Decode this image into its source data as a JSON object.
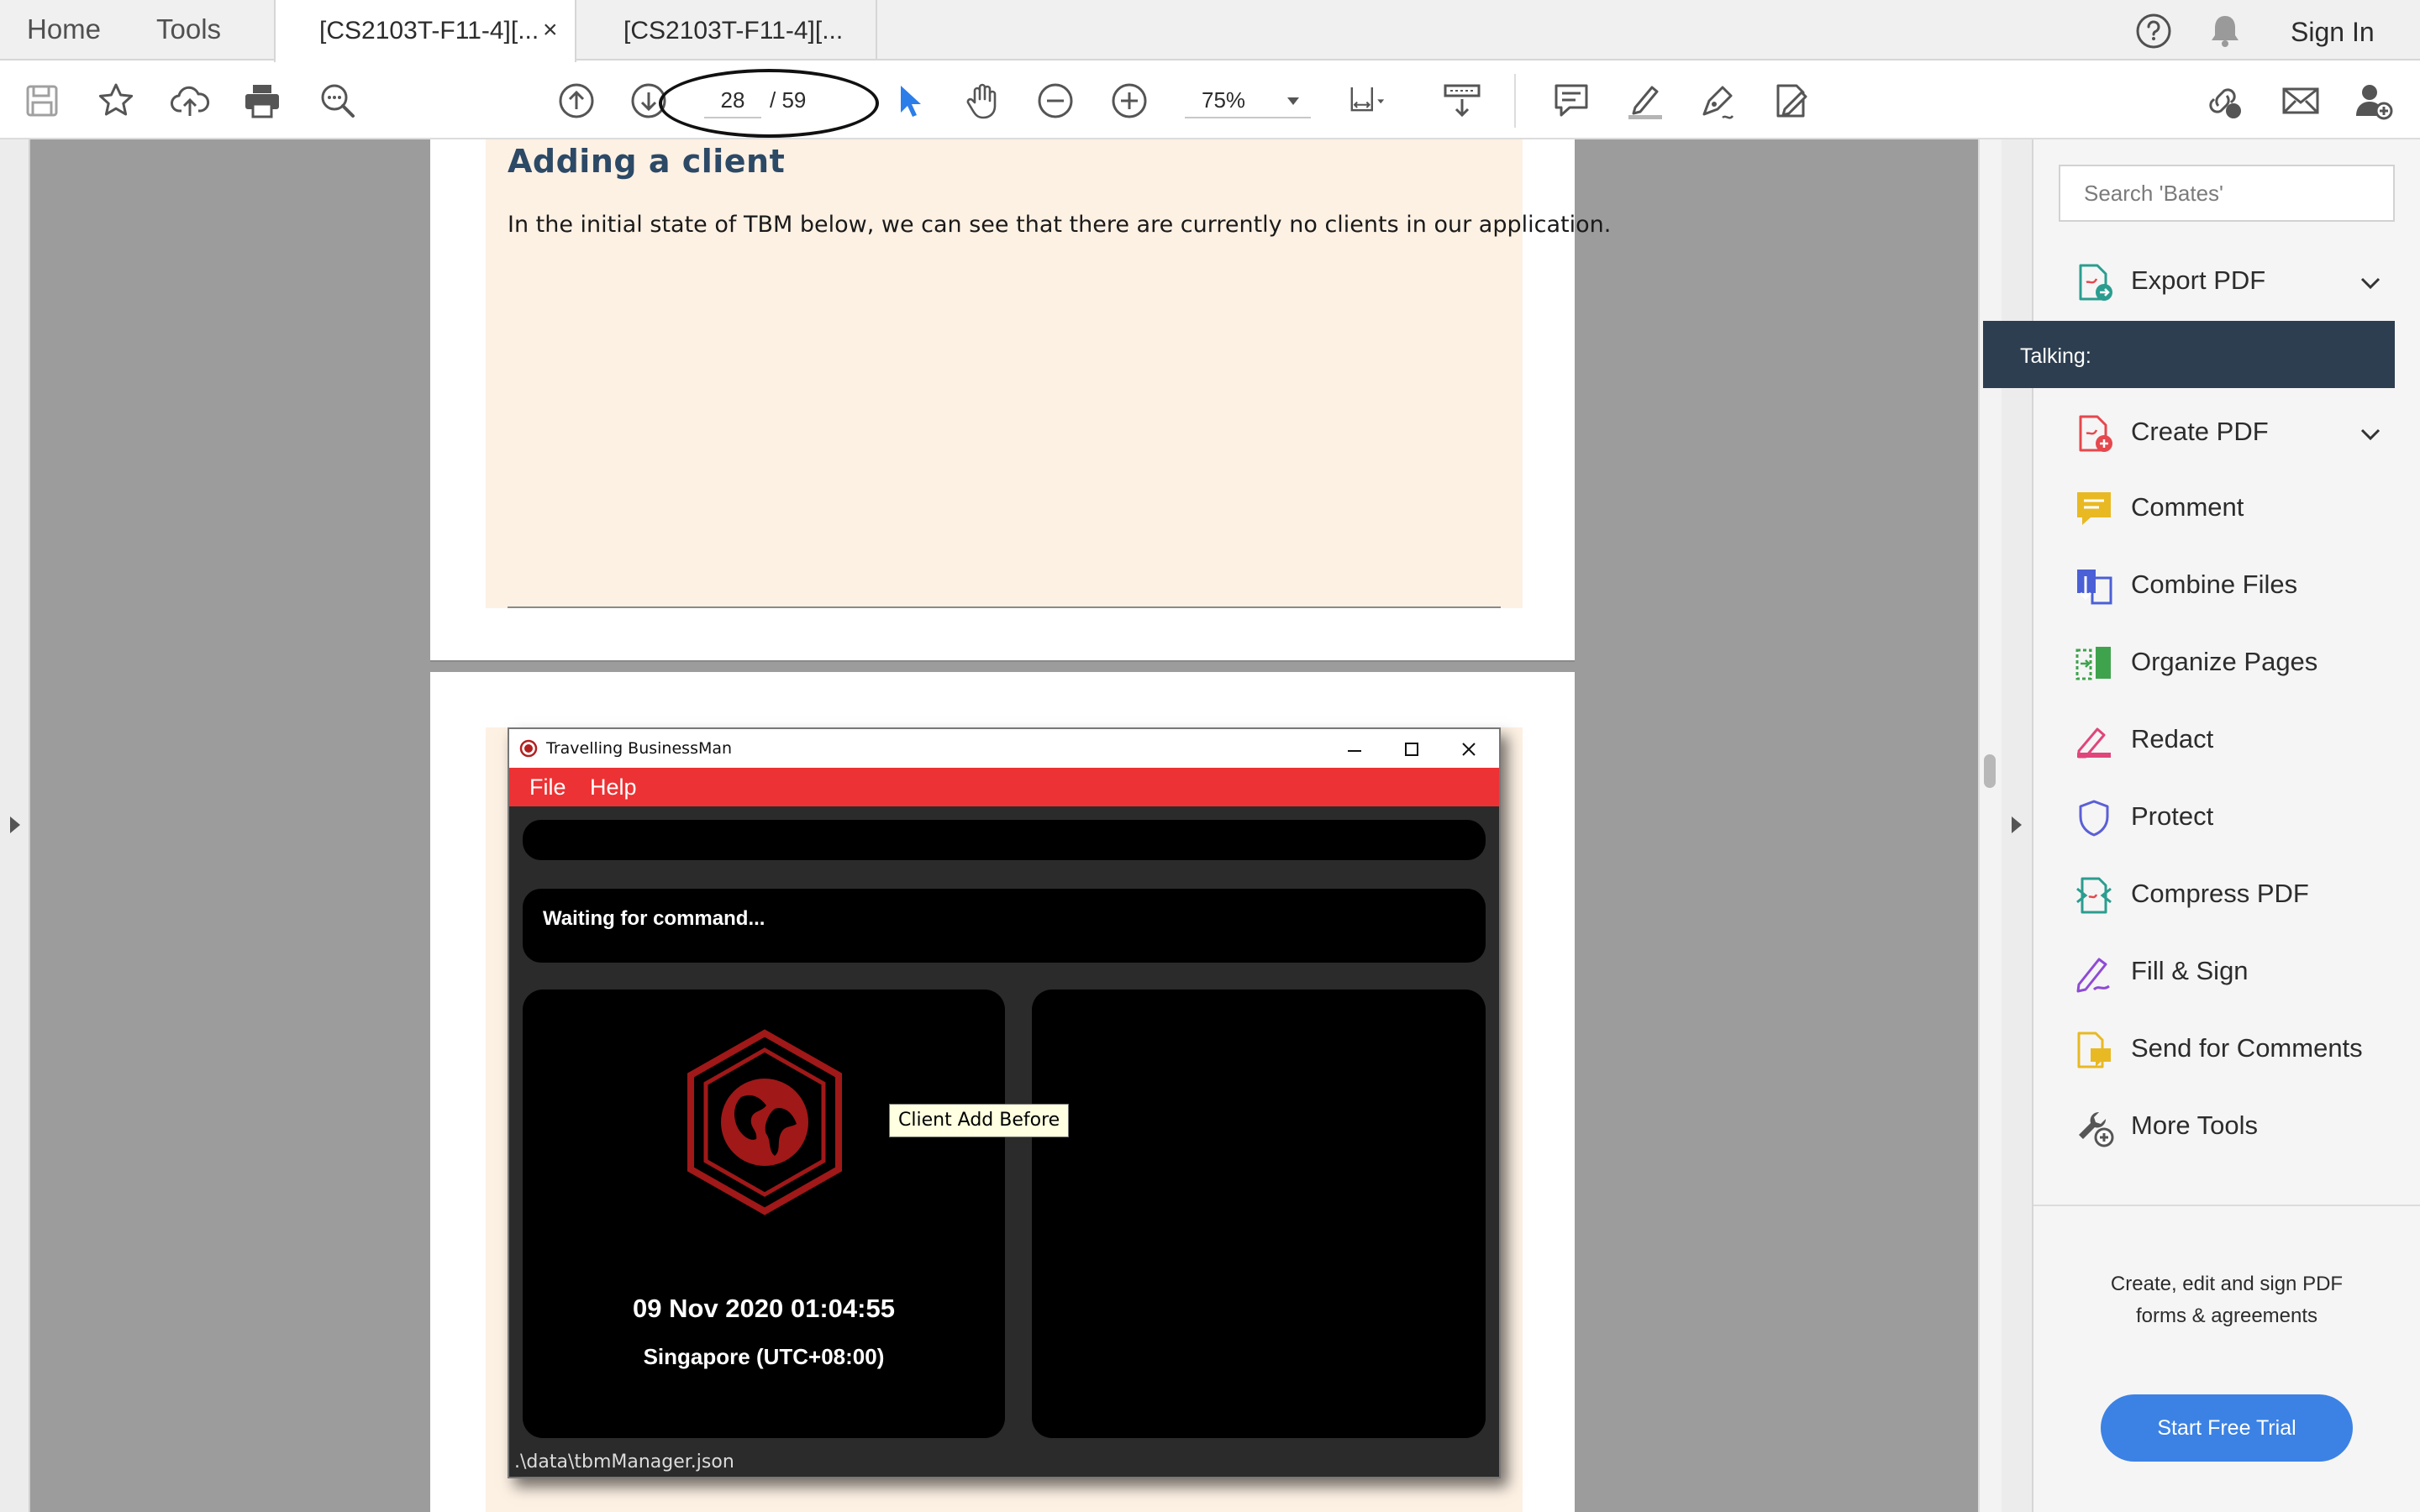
{
  "tabbar": {
    "home": "Home",
    "tools": "Tools",
    "doc_tabs": [
      {
        "label": "[CS2103T-F11-4][..."
      },
      {
        "label": "[CS2103T-F11-4][..."
      }
    ],
    "close_glyph": "×",
    "sign_in": "Sign In"
  },
  "toolbar": {
    "page_current": "28",
    "page_total": "/  59",
    "zoom": "75%"
  },
  "document": {
    "page1": {
      "heading": "Adding a client",
      "body": "In the initial state of TBM below, we can see that there are currently no clients in our application."
    },
    "app_window": {
      "title": "Travelling BusinessMan",
      "menu": [
        "File",
        "Help"
      ],
      "result_text": "Waiting for command...",
      "date_time": "09 Nov 2020 01:04:55",
      "timezone": "Singapore (UTC+08:00)",
      "status_path": ".\\data\\tbmManager.json",
      "tooltip": "Client Add Before"
    }
  },
  "tools_pane": {
    "search_placeholder": "Search 'Bates'",
    "tooltip": "Talking:",
    "items": [
      {
        "label": "Export PDF",
        "icon": "export-pdf-icon",
        "color": "#2a9d8f",
        "expandable": true
      },
      {
        "label": "Create PDF",
        "icon": "create-pdf-icon",
        "color": "#e5484d",
        "expandable": true
      },
      {
        "label": "Comment",
        "icon": "comment-icon",
        "color": "#e8b923",
        "expandable": false
      },
      {
        "label": "Combine Files",
        "icon": "combine-files-icon",
        "color": "#4b5fd6",
        "expandable": false
      },
      {
        "label": "Organize Pages",
        "icon": "organize-pages-icon",
        "color": "#3fa34d",
        "expandable": false
      },
      {
        "label": "Redact",
        "icon": "redact-icon",
        "color": "#e0457b",
        "expandable": false
      },
      {
        "label": "Protect",
        "icon": "protect-icon",
        "color": "#5b5fd6",
        "expandable": false
      },
      {
        "label": "Compress PDF",
        "icon": "compress-pdf-icon",
        "color": "#2a9d8f",
        "expandable": false
      },
      {
        "label": "Fill & Sign",
        "icon": "fill-sign-icon",
        "color": "#8e4bd6",
        "expandable": false
      },
      {
        "label": "Send for Comments",
        "icon": "send-for-comments-icon",
        "color": "#e8b923",
        "expandable": false
      },
      {
        "label": "More Tools",
        "icon": "more-tools-icon",
        "color": "#555555",
        "expandable": false
      }
    ],
    "promo_line1": "Create, edit and sign PDF",
    "promo_line2": "forms & agreements",
    "trial_button": "Start Free Trial"
  },
  "colors": {
    "accent_blue": "#3b82e4",
    "app_menubar_red": "#ec3234",
    "page_highlight": "#fdf1e4",
    "heading_navy": "#2c4966"
  }
}
